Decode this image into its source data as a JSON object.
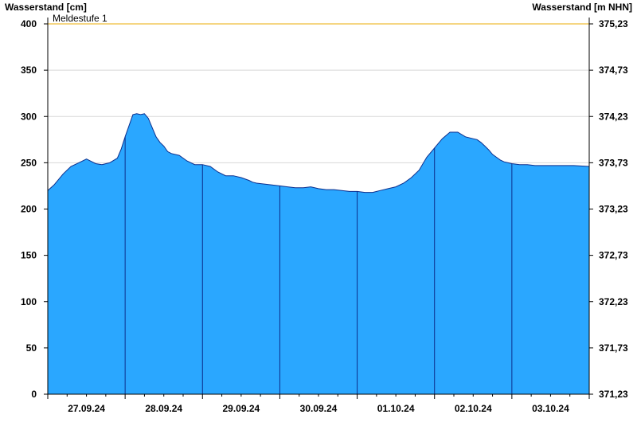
{
  "chart_data": {
    "type": "area",
    "ylabel_left": "Wasserstand [cm]",
    "ylabel_right": "Wasserstand [m NHN]",
    "ylim": [
      0,
      400
    ],
    "yticks_left": [
      "0",
      "50",
      "100",
      "150",
      "200",
      "250",
      "300",
      "350",
      "400"
    ],
    "yticks_right": [
      "371,23",
      "371,73",
      "372,23",
      "372,73",
      "373,23",
      "373,73",
      "374,23",
      "374,73",
      "375,23"
    ],
    "xlim_days": [
      0,
      7
    ],
    "x_start_day_offset": 0,
    "xtick_labels": [
      "27.09.24",
      "28.09.24",
      "29.09.24",
      "30.09.24",
      "01.10.24",
      "02.10.24",
      "03.10.24"
    ],
    "threshold": {
      "label": "Meldestufe 1",
      "value": 400,
      "color": "#f2c85a"
    },
    "colors": {
      "area": "#2aa7ff",
      "outline": "#0c2e8c",
      "grid": "#d8d8d8"
    },
    "series": [
      {
        "name": "",
        "x": [
          0,
          0.08,
          0.2,
          0.3,
          0.4,
          0.5,
          0.55,
          0.62,
          0.7,
          0.8,
          0.9,
          0.95,
          1.0,
          1.05,
          1.1,
          1.15,
          1.2,
          1.25,
          1.3,
          1.35,
          1.4,
          1.45,
          1.5,
          1.55,
          1.6,
          1.7,
          1.8,
          1.9,
          2.0,
          2.1,
          2.2,
          2.3,
          2.4,
          2.5,
          2.6,
          2.65,
          2.7,
          2.8,
          2.9,
          3.0,
          3.1,
          3.2,
          3.3,
          3.4,
          3.5,
          3.6,
          3.7,
          3.8,
          3.9,
          4.0,
          4.1,
          4.2,
          4.3,
          4.4,
          4.5,
          4.6,
          4.7,
          4.8,
          4.9,
          5.0,
          5.1,
          5.2,
          5.3,
          5.4,
          5.5,
          5.55,
          5.6,
          5.65,
          5.7,
          5.75,
          5.8,
          5.85,
          5.9,
          6.0,
          6.1,
          6.2,
          6.3,
          6.4,
          6.5,
          6.6,
          6.7,
          6.8,
          7.0
        ],
        "y": [
          220,
          226,
          238,
          246,
          250,
          254,
          252,
          249,
          248,
          250,
          255,
          265,
          278,
          290,
          302,
          303,
          302,
          303,
          298,
          288,
          278,
          272,
          268,
          262,
          260,
          258,
          252,
          248,
          248,
          246,
          240,
          236,
          236,
          234,
          231,
          229,
          228,
          227,
          226,
          225,
          224,
          223,
          223,
          224,
          222,
          221,
          221,
          220,
          219,
          219,
          218,
          218,
          220,
          222,
          224,
          228,
          234,
          242,
          256,
          266,
          276,
          283,
          283,
          278,
          276,
          275,
          272,
          268,
          264,
          259,
          256,
          253,
          251,
          249,
          248,
          248,
          247,
          247,
          247,
          247,
          247,
          247,
          246
        ]
      }
    ],
    "grid": true
  }
}
